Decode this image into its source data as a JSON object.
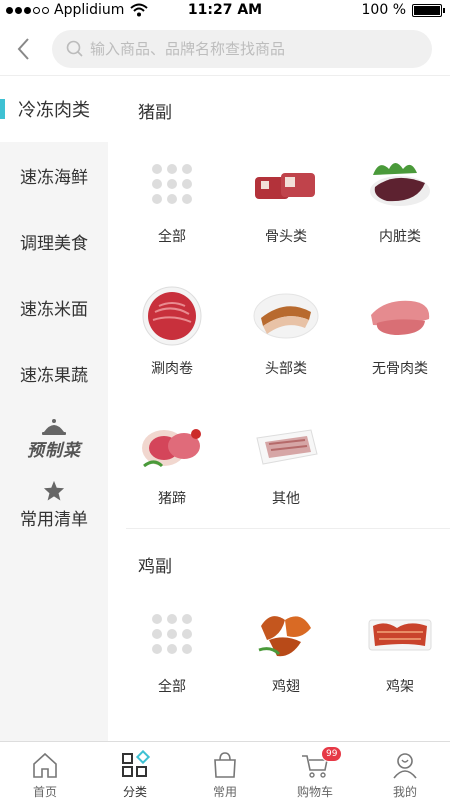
{
  "status_bar": {
    "carrier": "Applidium",
    "time": "11:27 AM",
    "battery": "100 %"
  },
  "search": {
    "placeholder": "输入商品、品牌名称查找商品"
  },
  "sidebar": {
    "items": [
      {
        "label": "冷冻肉类",
        "active": true
      },
      {
        "label": "速冻海鲜"
      },
      {
        "label": "调理美食"
      },
      {
        "label": "速冻米面"
      },
      {
        "label": "速冻果蔬"
      }
    ],
    "special_label": "预制菜",
    "favorites_label": "常用清单"
  },
  "sections": [
    {
      "title": "猪副",
      "items": [
        {
          "label": "全部",
          "icon": "all-grid-icon"
        },
        {
          "label": "骨头类",
          "icon": "bones-image"
        },
        {
          "label": "内脏类",
          "icon": "offal-image"
        },
        {
          "label": "涮肉卷",
          "icon": "meat-roll-image"
        },
        {
          "label": "头部类",
          "icon": "head-meat-image"
        },
        {
          "label": "无骨肉类",
          "icon": "boneless-meat-image"
        },
        {
          "label": "猪蹄",
          "icon": "trotter-image"
        },
        {
          "label": "其他",
          "icon": "other-image"
        }
      ]
    },
    {
      "title": "鸡副",
      "items": [
        {
          "label": "全部",
          "icon": "all-grid-icon"
        },
        {
          "label": "鸡翅",
          "icon": "chicken-wing-image"
        },
        {
          "label": "鸡架",
          "icon": "chicken-frame-image"
        }
      ]
    }
  ],
  "tabbar": {
    "items": [
      {
        "label": "首页",
        "icon": "home-icon"
      },
      {
        "label": "分类",
        "icon": "category-icon",
        "active": true
      },
      {
        "label": "常用",
        "icon": "bag-icon"
      },
      {
        "label": "购物车",
        "icon": "cart-icon",
        "badge": "99"
      },
      {
        "label": "我的",
        "icon": "user-icon"
      }
    ]
  },
  "colors": {
    "accent": "#3ec1d3",
    "badge": "#e63946",
    "sidebar_bg": "#f5f5f5"
  }
}
